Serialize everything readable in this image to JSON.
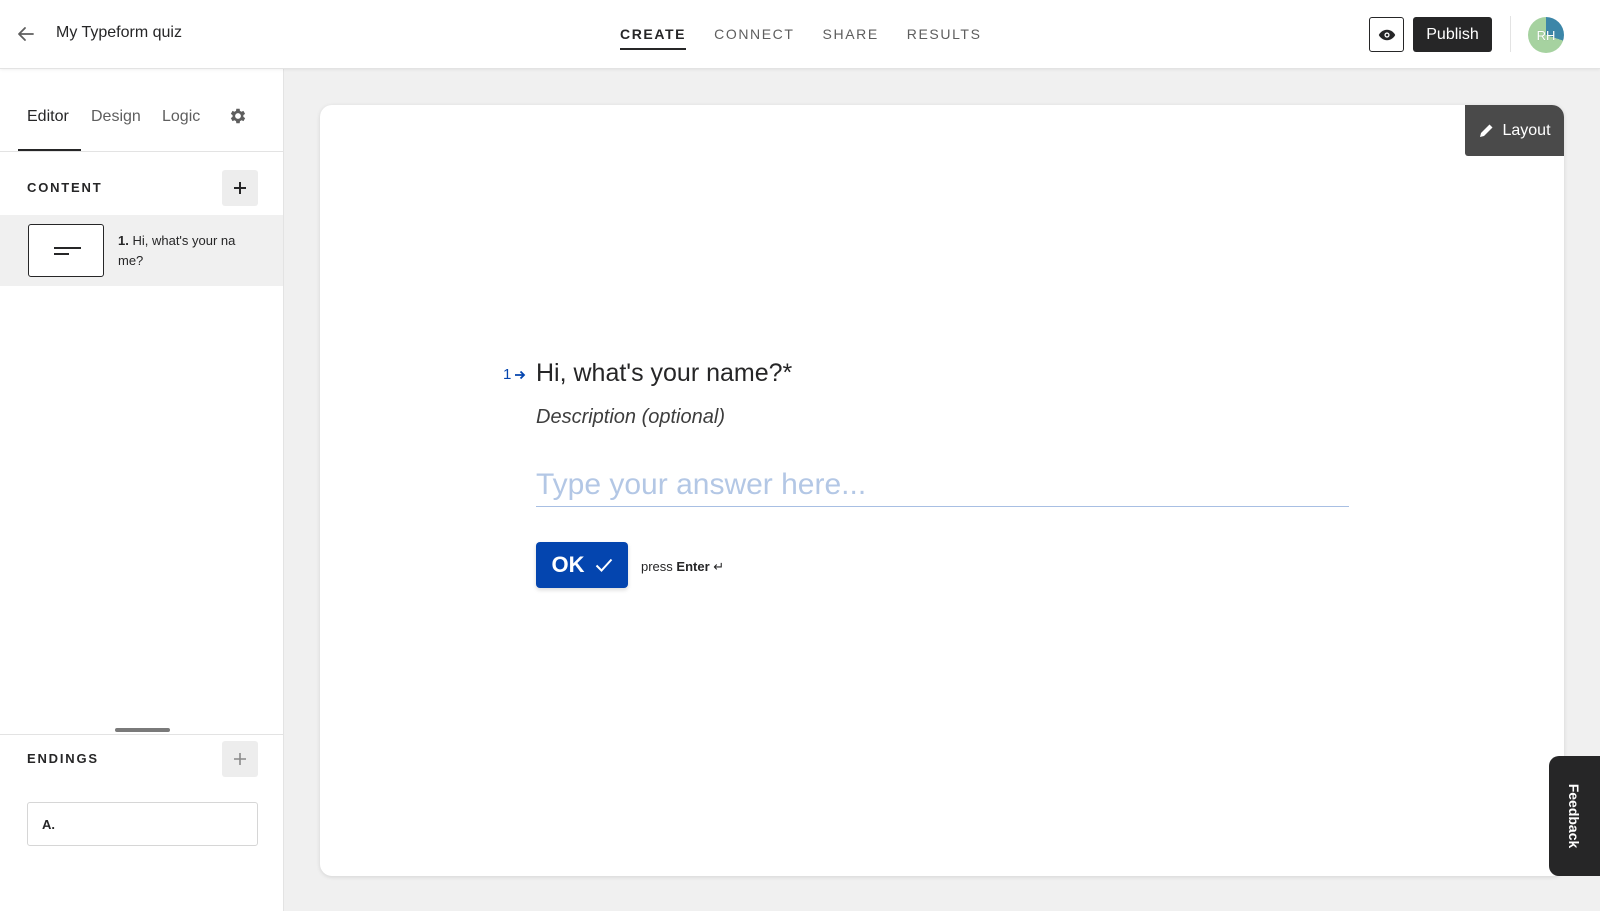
{
  "header": {
    "form_title": "My Typeform quiz",
    "tabs": [
      {
        "label": "CREATE",
        "active": true
      },
      {
        "label": "CONNECT",
        "active": false
      },
      {
        "label": "SHARE",
        "active": false
      },
      {
        "label": "RESULTS",
        "active": false
      }
    ],
    "publish_label": "Publish",
    "avatar_initials": "RH"
  },
  "sidebar": {
    "tabs": [
      {
        "label": "Editor",
        "active": true
      },
      {
        "label": "Design",
        "active": false
      },
      {
        "label": "Logic",
        "active": false
      }
    ],
    "content_title": "CONTENT",
    "content_items": [
      {
        "number": "1.",
        "text": "Hi, what's your name?"
      }
    ],
    "endings_title": "ENDINGS",
    "endings": [
      {
        "label": "A."
      }
    ]
  },
  "canvas": {
    "layout_label": "Layout",
    "question_number": "1",
    "question_title": "Hi, what's your name?*",
    "description_placeholder": "Description (optional)",
    "answer_placeholder": "Type your answer here...",
    "ok_label": "OK",
    "press_label": "press",
    "enter_label": "Enter",
    "enter_symbol": "↵"
  },
  "feedback_label": "Feedback",
  "colors": {
    "accent": "#0445af",
    "dark": "#262627"
  }
}
